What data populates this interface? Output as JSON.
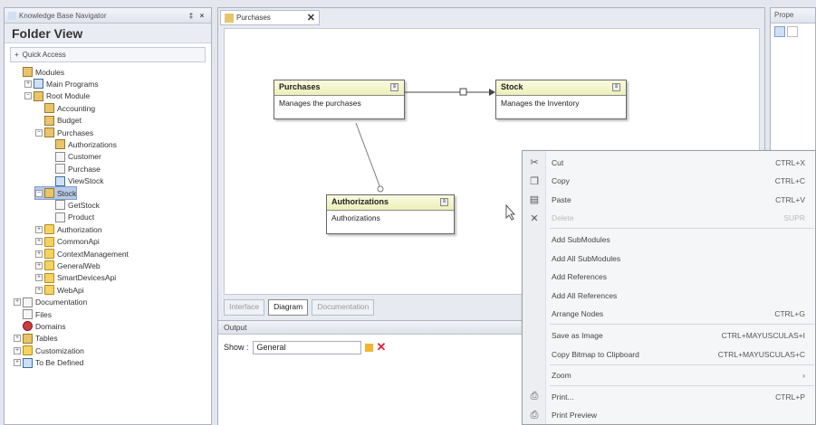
{
  "left_panel": {
    "title": "Knowledge Base Navigator",
    "pin": "‡",
    "close": "×",
    "heading": "Folder View",
    "quick_access": "Quick Access",
    "tree": [
      {
        "label": "Modules",
        "depth": 0,
        "icon": "modules",
        "expander": ""
      },
      {
        "label": "Main Programs",
        "depth": 1,
        "icon": "blue",
        "expander": "+"
      },
      {
        "label": "Root Module",
        "depth": 1,
        "icon": "mod",
        "expander": "-"
      },
      {
        "label": "Accounting",
        "depth": 2,
        "icon": "mod",
        "expander": ""
      },
      {
        "label": "Budget",
        "depth": 2,
        "icon": "mod",
        "expander": ""
      },
      {
        "label": "Purchases",
        "depth": 2,
        "icon": "mod",
        "expander": "-"
      },
      {
        "label": "Authorizations",
        "depth": 3,
        "icon": "mod",
        "expander": ""
      },
      {
        "label": "Customer",
        "depth": 3,
        "icon": "doc",
        "expander": ""
      },
      {
        "label": "Purchase",
        "depth": 3,
        "icon": "doc",
        "expander": ""
      },
      {
        "label": "ViewStock",
        "depth": 3,
        "icon": "blue",
        "expander": ""
      },
      {
        "label": "Stock",
        "depth": 2,
        "icon": "mod",
        "expander": "-",
        "selected": true
      },
      {
        "label": "GetStock",
        "depth": 3,
        "icon": "doc",
        "expander": ""
      },
      {
        "label": "Product",
        "depth": 3,
        "icon": "doc",
        "expander": ""
      },
      {
        "label": "Authorization",
        "depth": 2,
        "icon": "fold",
        "expander": "+"
      },
      {
        "label": "CommonApi",
        "depth": 2,
        "icon": "fold",
        "expander": "+"
      },
      {
        "label": "ContextManagement",
        "depth": 2,
        "icon": "fold",
        "expander": "+"
      },
      {
        "label": "GeneralWeb",
        "depth": 2,
        "icon": "fold",
        "expander": "+"
      },
      {
        "label": "SmartDevicesApi",
        "depth": 2,
        "icon": "fold",
        "expander": "+"
      },
      {
        "label": "WebApi",
        "depth": 2,
        "icon": "fold",
        "expander": "+"
      },
      {
        "label": "Documentation",
        "depth": 0,
        "icon": "doc",
        "expander": "+"
      },
      {
        "label": "Files",
        "depth": 0,
        "icon": "doc",
        "expander": ""
      },
      {
        "label": "Domains",
        "depth": 0,
        "icon": "red",
        "expander": ""
      },
      {
        "label": "Tables",
        "depth": 0,
        "icon": "mod",
        "expander": "+"
      },
      {
        "label": "Customization",
        "depth": 0,
        "icon": "fold",
        "expander": "+"
      },
      {
        "label": "To Be Defined",
        "depth": 0,
        "icon": "blue",
        "expander": "+"
      }
    ]
  },
  "document_tab": {
    "label": "Purchases",
    "close": "✕"
  },
  "diagram": {
    "nodes": [
      {
        "id": "purchases",
        "title": "Purchases",
        "desc": "Manages the purchases"
      },
      {
        "id": "stock",
        "title": "Stock",
        "desc": "Manages the Inventory"
      },
      {
        "id": "authorizations",
        "title": "Authorizations",
        "desc": "Authorizations"
      }
    ]
  },
  "bottom_tabs": [
    "Interface",
    "Diagram",
    "Documentation"
  ],
  "output": {
    "title": "Output",
    "show_label": "Show :",
    "show_value": "General"
  },
  "properties": {
    "title": "Prope"
  },
  "context_menu": [
    {
      "label": "Cut",
      "shortcut": "CTRL+X",
      "icon": "✂",
      "disabled": false
    },
    {
      "label": "Copy",
      "shortcut": "CTRL+C",
      "icon": "❐",
      "disabled": false
    },
    {
      "label": "Paste",
      "shortcut": "CTRL+V",
      "icon": "▤",
      "disabled": false
    },
    {
      "label": "Delete",
      "shortcut": "SUPR",
      "icon": "✕",
      "disabled": true
    },
    {
      "label": "Add SubModules",
      "shortcut": "",
      "icon": "",
      "disabled": false
    },
    {
      "label": "Add All SubModules",
      "shortcut": "",
      "icon": "",
      "disabled": false
    },
    {
      "label": "Add References",
      "shortcut": "",
      "icon": "",
      "disabled": false
    },
    {
      "label": "Add All References",
      "shortcut": "",
      "icon": "",
      "disabled": false
    },
    {
      "label": "Arrange Nodes",
      "shortcut": "CTRL+G",
      "icon": "",
      "disabled": false
    },
    {
      "label": "Save as Image",
      "shortcut": "CTRL+MAYUSCULAS+I",
      "icon": "",
      "disabled": false
    },
    {
      "label": "Copy Bitmap to Clipboard",
      "shortcut": "CTRL+MAYUSCULAS+C",
      "icon": "",
      "disabled": false
    },
    {
      "label": "Zoom",
      "shortcut": "›",
      "icon": "",
      "disabled": false
    },
    {
      "label": "Print...",
      "shortcut": "CTRL+P",
      "icon": "⎙",
      "disabled": false
    },
    {
      "label": "Print Preview",
      "shortcut": "",
      "icon": "⎙",
      "disabled": false
    }
  ]
}
